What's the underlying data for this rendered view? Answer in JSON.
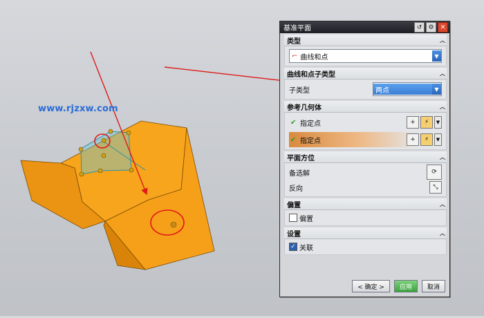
{
  "watermark": "www.rjzxw.com",
  "dialog": {
    "title": "基准平面",
    "title_icons": [
      "reset-icon",
      "gear-icon",
      "close-icon"
    ],
    "sections": {
      "type": {
        "header": "类型",
        "combo_value": "曲线和点"
      },
      "subtype": {
        "header": "曲线和点子类型",
        "field_label": "子类型",
        "combo_value": "两点"
      },
      "reference": {
        "header": "参考几何体",
        "rows": [
          {
            "label": "指定点",
            "status": "done"
          },
          {
            "label": "指定点",
            "status": "active"
          }
        ]
      },
      "orientation": {
        "header": "平面方位",
        "alt_label": "备选解",
        "reverse_label": "反向"
      },
      "offset": {
        "header": "偏置",
        "checkbox_label": "偏置",
        "checked": false
      },
      "settings": {
        "header": "设置",
        "checkbox_label": "关联",
        "checked": true
      }
    },
    "buttons": {
      "ok": "< 确定 >",
      "apply": "应用",
      "cancel": "取消"
    }
  },
  "colors": {
    "part_face": "#f5a623",
    "annotation_red": "#e01818",
    "watermark": "#2a6cd6",
    "title_bar": "#1d1f24"
  }
}
